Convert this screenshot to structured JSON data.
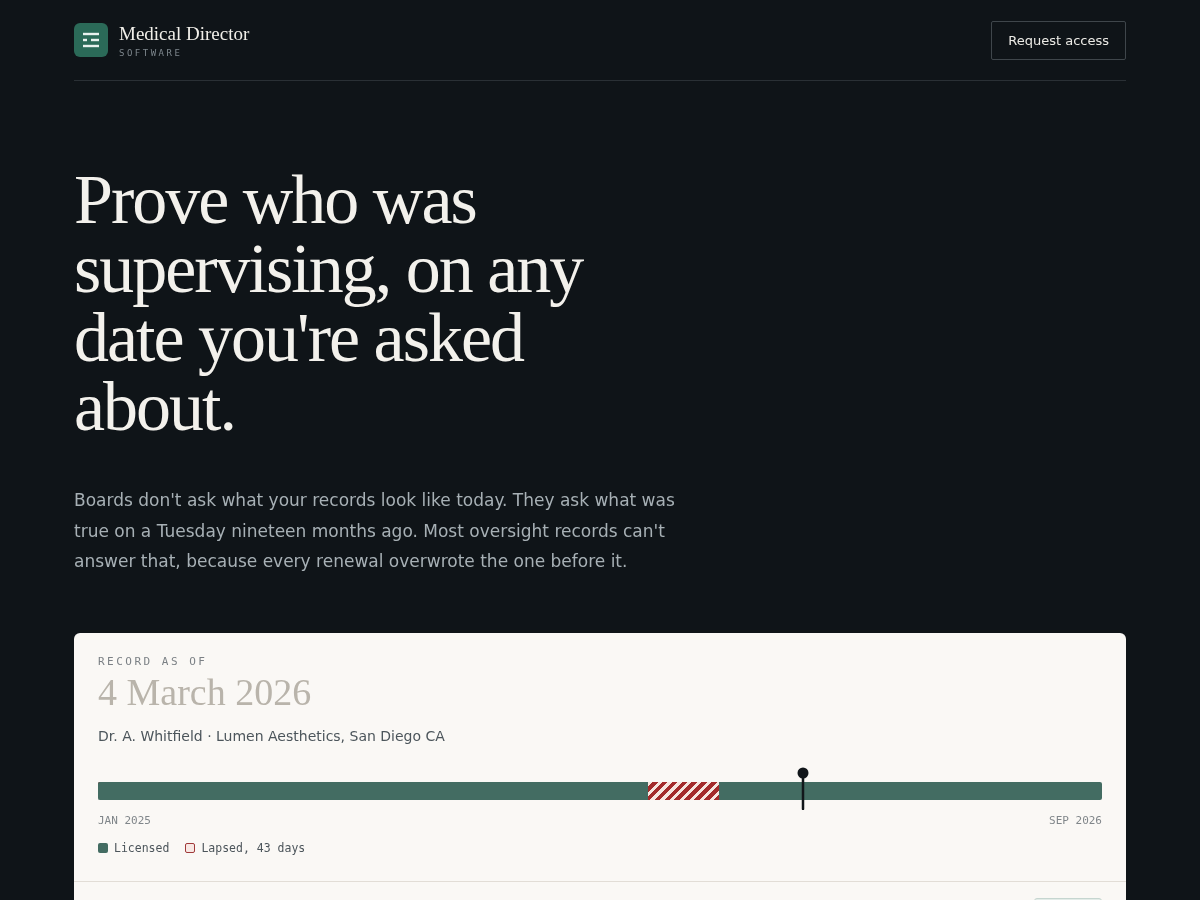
{
  "brand": {
    "name": "Medical Director",
    "tagline": "SOFTWARE"
  },
  "header": {
    "cta": "Request access"
  },
  "hero": {
    "headline": "Prove who was supervising, on any date you're asked about.",
    "body": "Boards don't ask what your records look like today. They ask what was true on a Tuesday nineteen months ago. Most oversight records can't answer that, because every renewal overwrote the one before it."
  },
  "record": {
    "eyebrow": "RECORD AS OF",
    "date": "4 March 2026",
    "subject": "Dr. A. Whitfield · Lumen Aesthetics, San Diego CA",
    "timeline": {
      "lapse_end": {
        "level": 0.619
      },
      "lapse_start": {
        "level": 0.548
      },
      "marker": {
        "level": 0.702
      },
      "start_label": "JAN 2025",
      "end_label": "SEP 2026"
    },
    "legend": [
      {
        "kind": "licensed",
        "label": "Licensed"
      },
      {
        "kind": "lapsed",
        "label": "Lapsed, 43 days"
      }
    ]
  }
}
